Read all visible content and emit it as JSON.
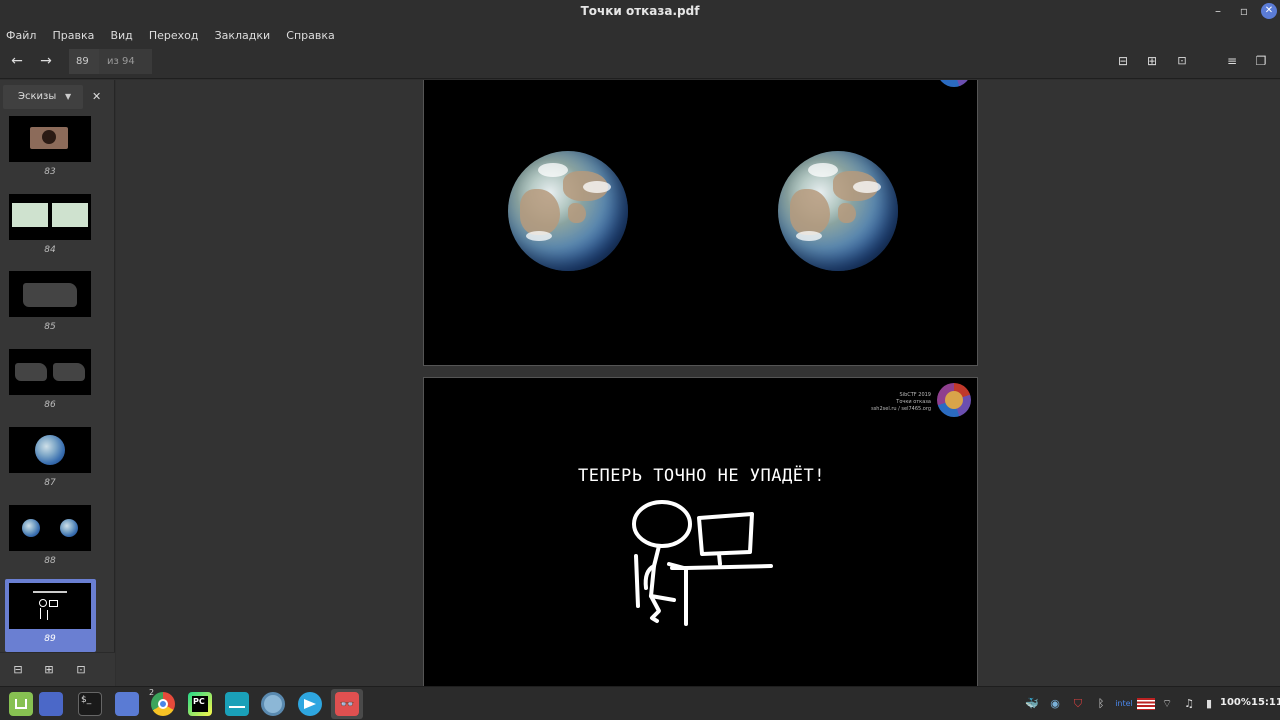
{
  "window": {
    "title": "Точки отказа.pdf"
  },
  "menu": [
    "Файл",
    "Правка",
    "Вид",
    "Переход",
    "Закладки",
    "Справка"
  ],
  "toolbar": {
    "current_page": "89",
    "total_pages": "из 94"
  },
  "sidebar": {
    "mode_label": "Эскизы",
    "thumbnails": [
      {
        "label": "83"
      },
      {
        "label": "84"
      },
      {
        "label": "85"
      },
      {
        "label": "86"
      },
      {
        "label": "87"
      },
      {
        "label": "88"
      },
      {
        "label": "89",
        "selected": true
      }
    ]
  },
  "slide_89": {
    "title": "ТЕПЕРЬ ТОЧНО НЕ УПАДЁТ!",
    "header_lines": [
      "SibCTF 2019",
      "Точки отказа",
      "ssh2sel.ru / sel7465.org"
    ]
  },
  "taskbar": {
    "browser_badge": "2",
    "battery": "100%",
    "clock": "15:11"
  },
  "colors": {
    "accent": "#6a7fd2",
    "background": "#2f2f2f",
    "slide": "#000000"
  }
}
